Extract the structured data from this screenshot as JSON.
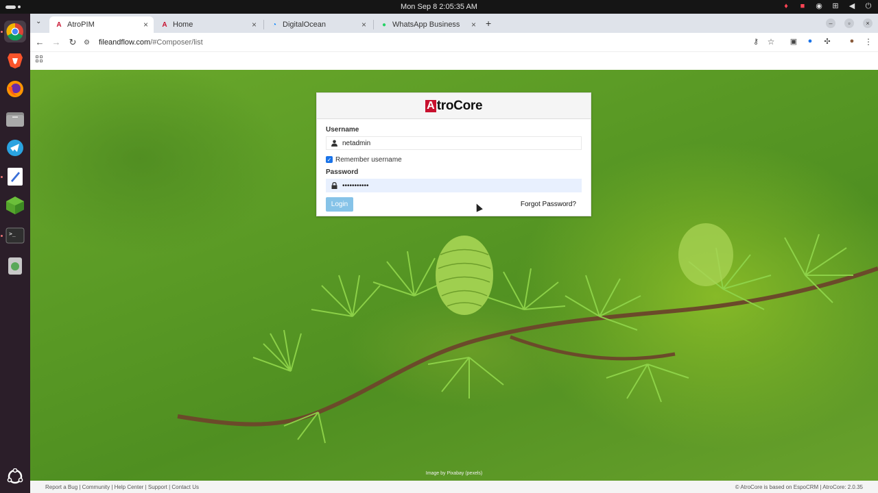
{
  "system": {
    "clock": "Mon Sep 8   2:05:35 AM",
    "tray_icons": [
      "brave-shield-icon",
      "camera-icon",
      "chrome-icon",
      "network-icon",
      "volume-icon",
      "power-icon"
    ]
  },
  "dock": {
    "apps": [
      "chrome-icon",
      "brave-icon",
      "firefox-icon",
      "files-icon",
      "telegram-icon",
      "text-editor-icon",
      "minecraft-icon",
      "terminal-icon",
      "trash-icon",
      "ubuntu-logo-icon"
    ]
  },
  "browser": {
    "tabs": [
      {
        "label": "AtroPIM",
        "icon": "atro-icon",
        "active": true
      },
      {
        "label": "Home",
        "icon": "atro-icon",
        "active": false
      },
      {
        "label": "DigitalOcean",
        "icon": "digitalocean-icon",
        "active": false
      },
      {
        "label": "WhatsApp Business",
        "icon": "whatsapp-icon",
        "active": false
      }
    ],
    "url_domain": "fileandflow.com",
    "url_path": "/#Composer/list"
  },
  "login": {
    "brand_mark": "A",
    "brand_rest": "troCore",
    "username_label": "Username",
    "username_value": "netadmin",
    "remember_label": "Remember username",
    "remember_checked": true,
    "password_label": "Password",
    "password_value": "•••••••••••",
    "login_button": "Login",
    "forgot_link": "Forgot Password?"
  },
  "page": {
    "image_credit": "Image by Pixabay (pexels)",
    "footer_links": "Report a Bug | Community | Help Center | Support | Contact Us",
    "footer_copyright": "© AtroCore is based on EspoCRM | AtroCore: 2.0.35"
  },
  "colors": {
    "brand_red": "#c8102e",
    "login_button": "#86c3e8",
    "background_green": "#5a9a25"
  }
}
